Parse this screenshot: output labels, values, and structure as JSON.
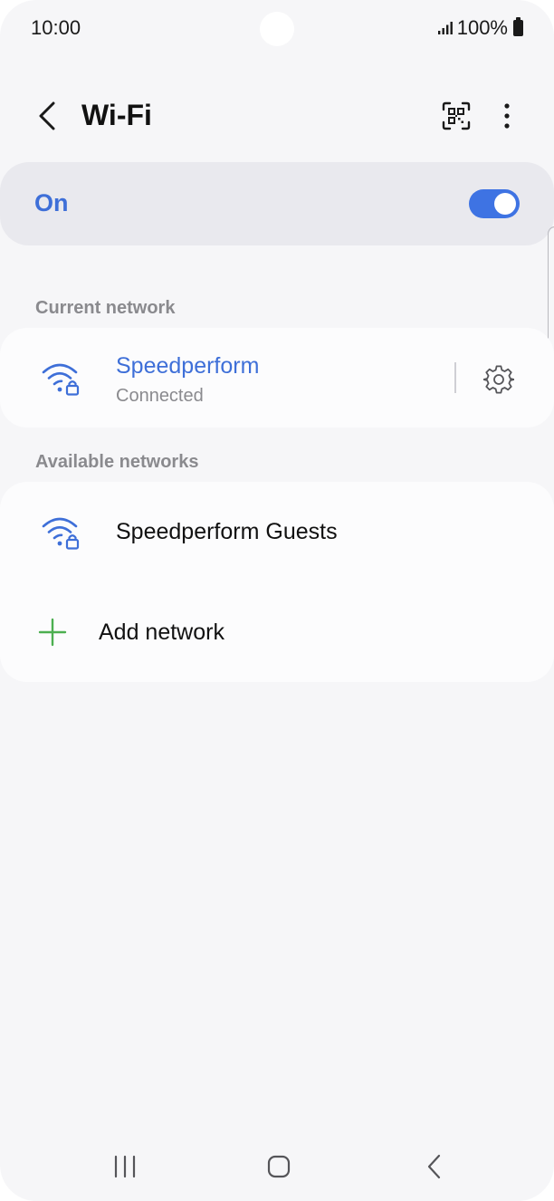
{
  "status_bar": {
    "time": "10:00",
    "battery": "100%",
    "icons": [
      "signal-icon",
      "battery-icon"
    ]
  },
  "header": {
    "title": "Wi-Fi",
    "icons": [
      "back-arrow-icon",
      "qr-code-scan-icon",
      "more-vert-icon"
    ]
  },
  "toggle": {
    "label": "On",
    "state": true
  },
  "current_network": {
    "section_label": "Current network",
    "name": "Speedperform",
    "status": "Connected",
    "icons": [
      "wifi-lock-icon",
      "gear-icon"
    ]
  },
  "available_networks": {
    "section_label": "Available networks",
    "items": [
      {
        "name": "Speedperform Guests",
        "icon": "wifi-lock-icon"
      }
    ],
    "add_label": "Add network"
  },
  "nav_bar": {
    "icons": [
      "recents-icon",
      "home-icon",
      "back-icon"
    ]
  },
  "colors": {
    "accent": "#3e6fd8",
    "switch_on": "#3e73e3",
    "add_plus": "#4caf50",
    "background": "#f6f6f8",
    "card": "#fcfcfd"
  }
}
